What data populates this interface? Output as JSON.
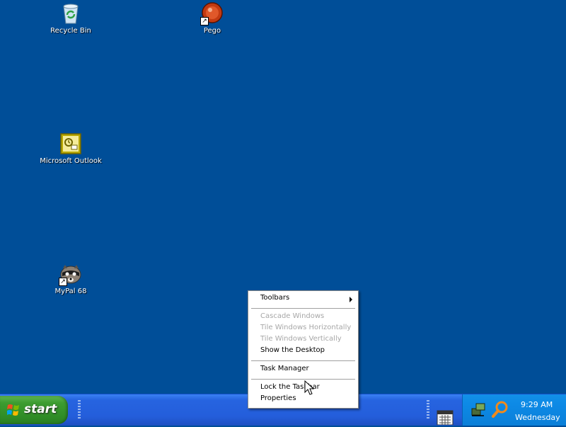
{
  "desktop": {
    "icons": [
      {
        "label": "Recycle Bin",
        "icon": "recycle-bin-icon"
      },
      {
        "label": "Pego",
        "icon": "pego-icon"
      },
      {
        "label": "Microsoft Outlook",
        "icon": "outlook-icon"
      },
      {
        "label": "MyPal 68",
        "icon": "mypal-icon"
      }
    ]
  },
  "taskbar": {
    "start_label": "start",
    "clock_time": "9:29 AM",
    "clock_day": "Wednesday"
  },
  "context_menu": {
    "items": [
      {
        "label": "Toolbars",
        "enabled": true,
        "submenu": true
      },
      {
        "label": "Cascade Windows",
        "enabled": false
      },
      {
        "label": "Tile Windows Horizontally",
        "enabled": false
      },
      {
        "label": "Tile Windows Vertically",
        "enabled": false
      },
      {
        "label": "Show the Desktop",
        "enabled": true
      },
      {
        "label": "Task Manager",
        "enabled": true
      },
      {
        "label": "Lock the Taskbar",
        "enabled": true
      },
      {
        "label": "Properties",
        "enabled": true
      }
    ]
  },
  "colors": {
    "desktop_bg": "#004e98",
    "taskbar_blue": "#245edb",
    "start_green": "#3c9c30",
    "tray_blue": "#0d8ae6",
    "disabled_text": "#a7a7a7"
  }
}
